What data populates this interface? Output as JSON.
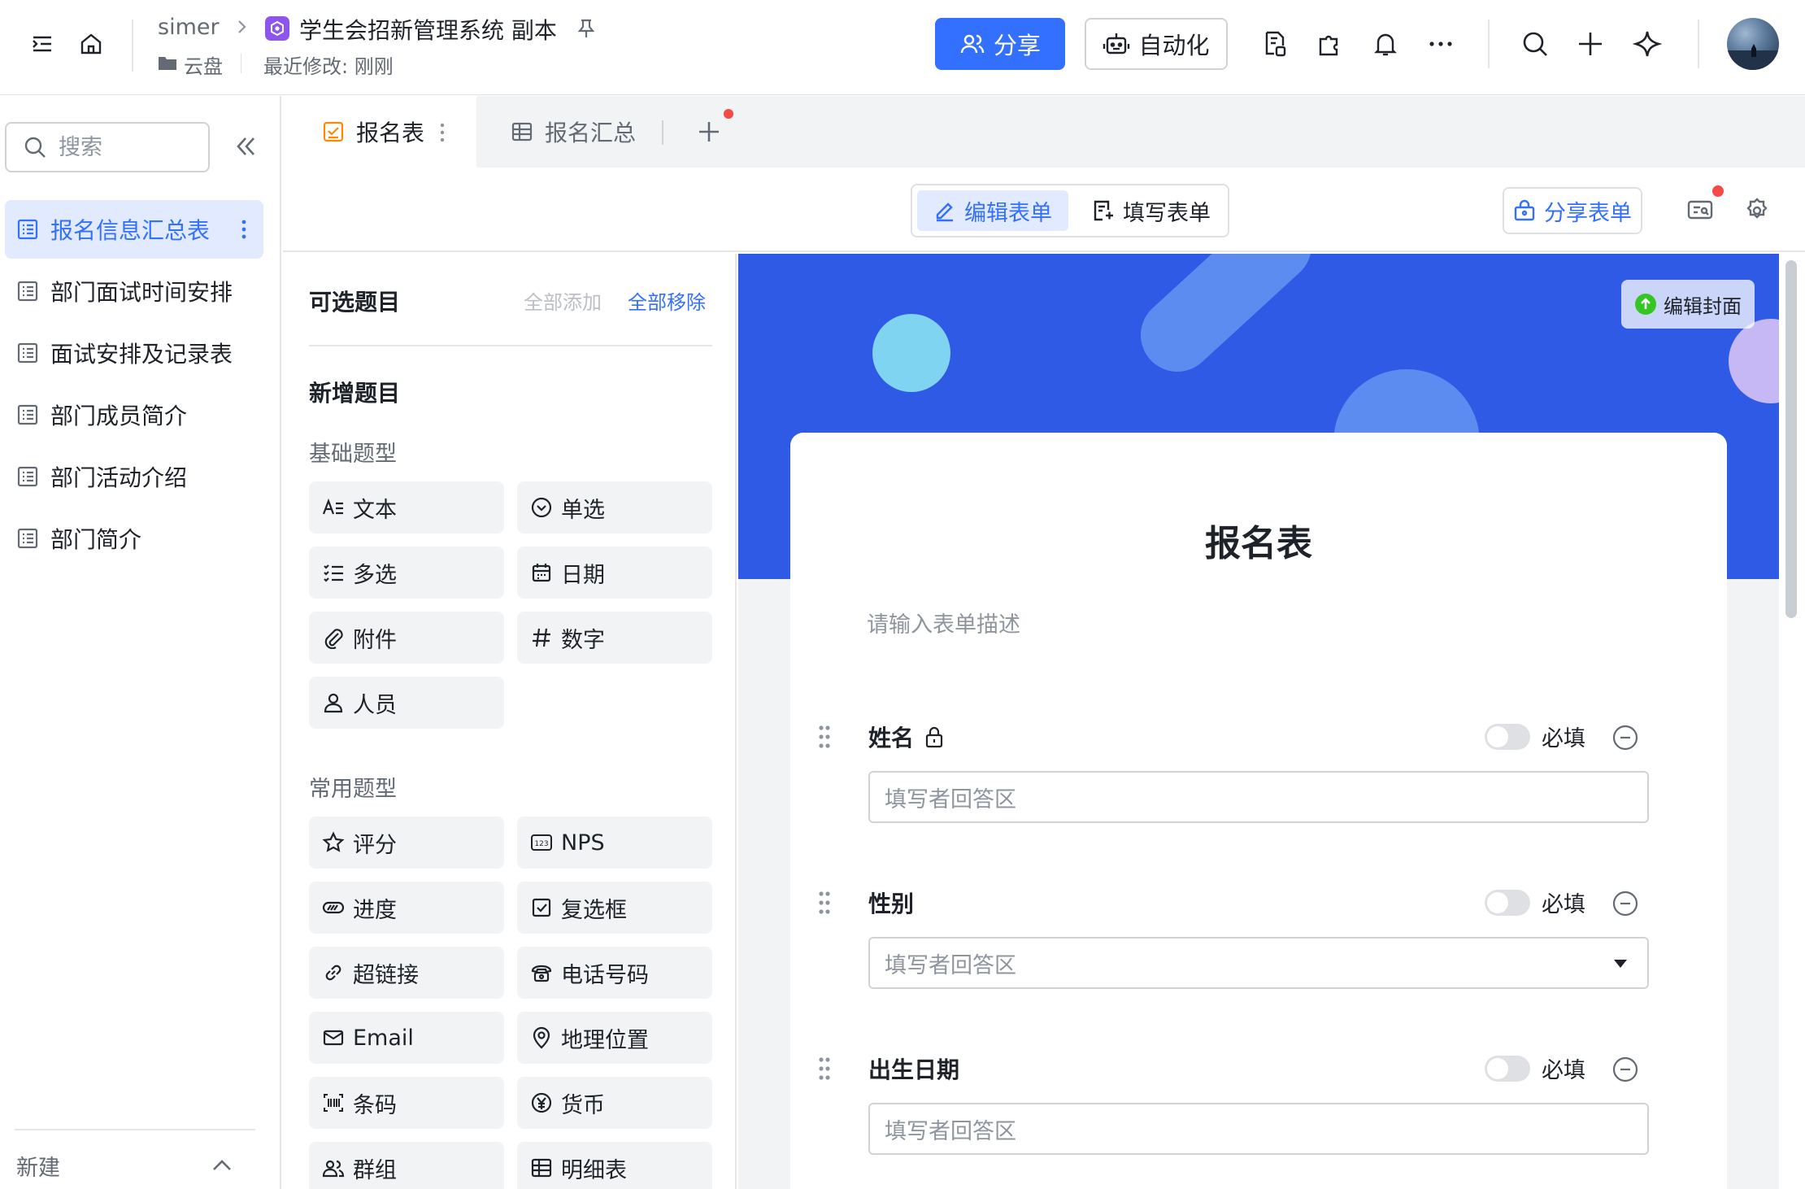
{
  "header": {
    "owner": "simer",
    "doc_title": "学生会招新管理系统 副本",
    "location": "云盘",
    "modified": "最近修改: 刚刚",
    "share_label": "分享",
    "automation_label": "自动化"
  },
  "sidebar": {
    "search_placeholder": "搜索",
    "items": [
      {
        "label": "报名信息汇总表",
        "active": true
      },
      {
        "label": "部门面试时间安排"
      },
      {
        "label": "面试安排及记录表"
      },
      {
        "label": "部门成员简介"
      },
      {
        "label": "部门活动介绍"
      },
      {
        "label": "部门简介"
      }
    ],
    "new_label": "新建"
  },
  "tabs": [
    {
      "label": "报名表",
      "active": true
    },
    {
      "label": "报名汇总"
    }
  ],
  "toolbar": {
    "edit_form": "编辑表单",
    "fill_form": "填写表单",
    "share_form": "分享表单"
  },
  "question_panel": {
    "title": "可选题目",
    "add_all": "全部添加",
    "remove_all": "全部移除",
    "new_title": "新增题目",
    "basic_label": "基础题型",
    "basic": [
      {
        "label": "文本",
        "icon": "text-icon"
      },
      {
        "label": "单选",
        "icon": "single-select-icon"
      },
      {
        "label": "多选",
        "icon": "multi-select-icon"
      },
      {
        "label": "日期",
        "icon": "calendar-icon"
      },
      {
        "label": "附件",
        "icon": "attachment-icon"
      },
      {
        "label": "数字",
        "icon": "hash-icon"
      },
      {
        "label": "人员",
        "icon": "person-icon"
      }
    ],
    "common_label": "常用题型",
    "common": [
      {
        "label": "评分",
        "icon": "star-icon"
      },
      {
        "label": "NPS",
        "icon": "nps-icon"
      },
      {
        "label": "进度",
        "icon": "progress-icon"
      },
      {
        "label": "复选框",
        "icon": "checkbox-icon"
      },
      {
        "label": "超链接",
        "icon": "link-icon"
      },
      {
        "label": "电话号码",
        "icon": "phone-icon"
      },
      {
        "label": "Email",
        "icon": "email-icon"
      },
      {
        "label": "地理位置",
        "icon": "location-icon"
      },
      {
        "label": "条码",
        "icon": "barcode-icon"
      },
      {
        "label": "货币",
        "icon": "currency-icon"
      },
      {
        "label": "群组",
        "icon": "group-icon"
      },
      {
        "label": "明细表",
        "icon": "table-icon"
      }
    ]
  },
  "form": {
    "edit_cover": "编辑封面",
    "title": "报名表",
    "description_placeholder": "请输入表单描述",
    "required_label": "必填",
    "answer_placeholder": "填写者回答区",
    "fields": [
      {
        "label": "姓名",
        "locked": true,
        "type": "text"
      },
      {
        "label": "性别",
        "type": "select"
      },
      {
        "label": "出生日期",
        "type": "date"
      }
    ]
  },
  "colors": {
    "accent": "#3370ff",
    "cover": "#2f5ae5",
    "notification_dot": "#f54a45"
  }
}
